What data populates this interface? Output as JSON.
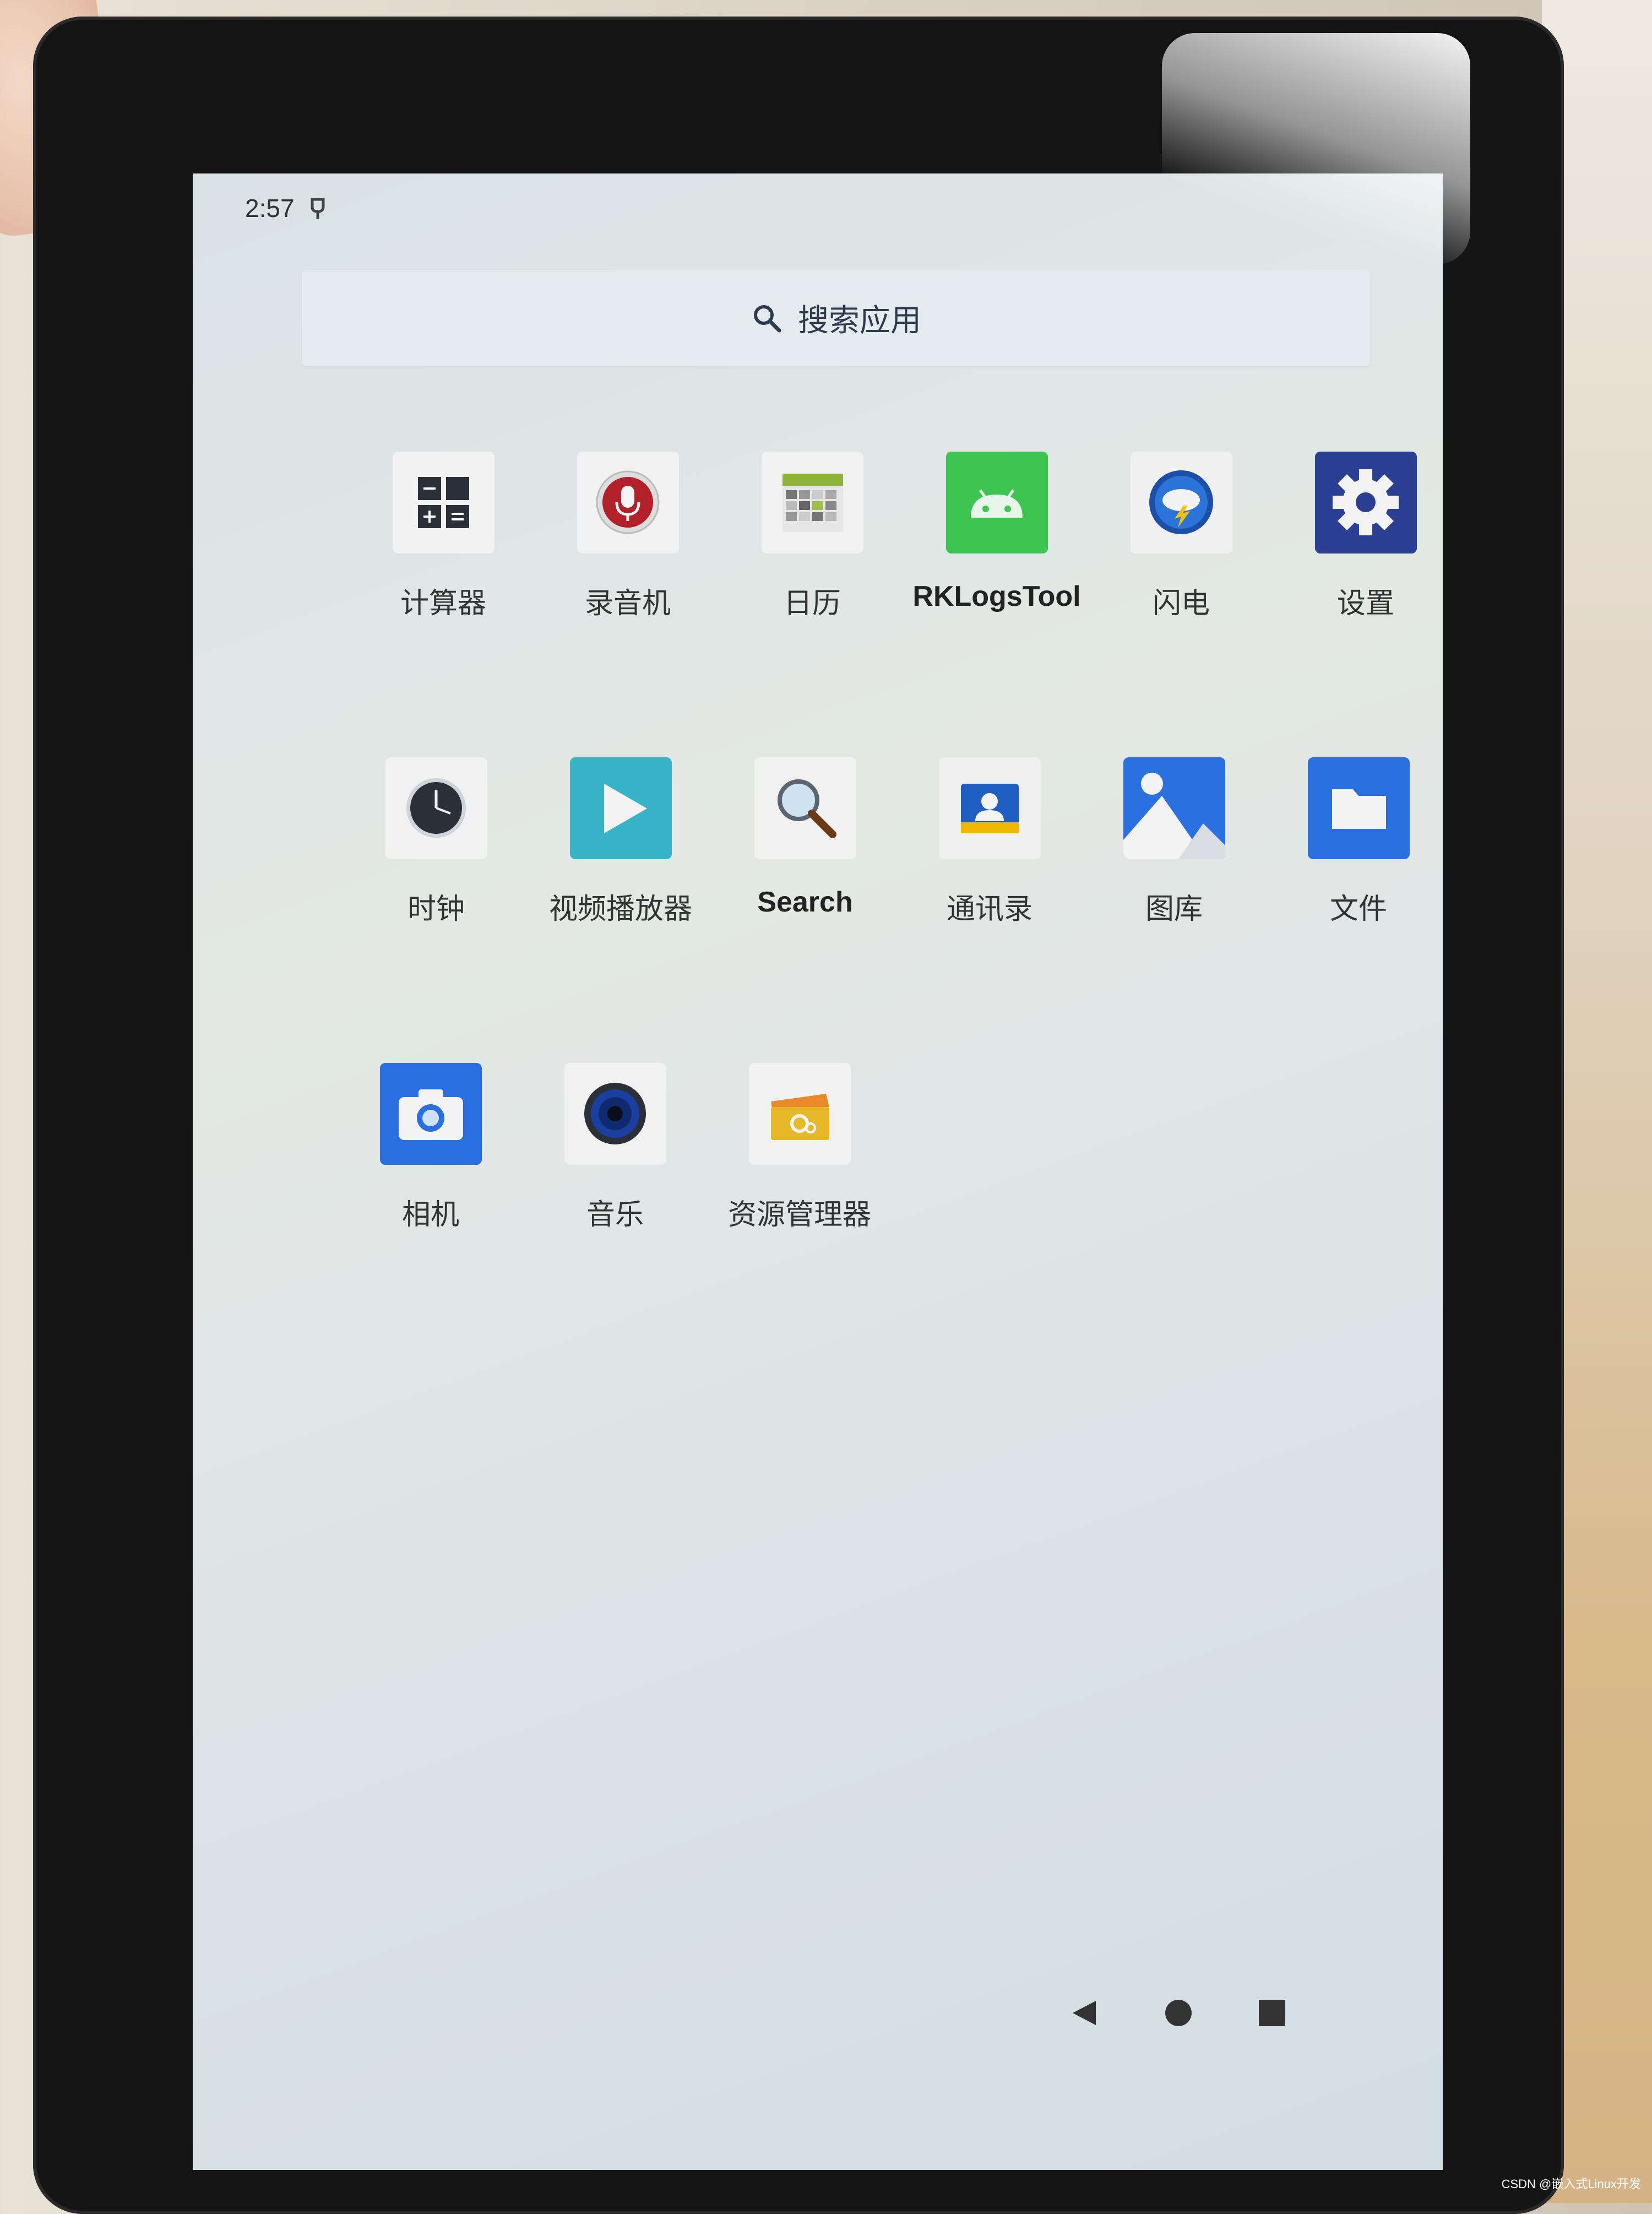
{
  "status_bar": {
    "time": "2:57"
  },
  "search": {
    "label": "搜索应用"
  },
  "apps": [
    {
      "id": "calculator",
      "label": "计算器",
      "icon": "calculator-icon"
    },
    {
      "id": "recorder",
      "label": "录音机",
      "icon": "microphone-icon"
    },
    {
      "id": "calendar",
      "label": "日历",
      "icon": "calendar-icon"
    },
    {
      "id": "rklogstool",
      "label": "RKLogsTool",
      "icon": "android-icon"
    },
    {
      "id": "flash",
      "label": "闪电",
      "icon": "lightning-icon"
    },
    {
      "id": "settings",
      "label": "设置",
      "icon": "gear-icon"
    },
    {
      "id": "clock",
      "label": "时钟",
      "icon": "clock-icon"
    },
    {
      "id": "video-player",
      "label": "视频播放器",
      "icon": "play-icon"
    },
    {
      "id": "search",
      "label": "Search",
      "icon": "magnifier-icon"
    },
    {
      "id": "contacts",
      "label": "通讯录",
      "icon": "contacts-icon"
    },
    {
      "id": "gallery",
      "label": "图库",
      "icon": "gallery-icon"
    },
    {
      "id": "files",
      "label": "文件",
      "icon": "folder-icon"
    },
    {
      "id": "camera",
      "label": "相机",
      "icon": "camera-icon"
    },
    {
      "id": "music",
      "label": "音乐",
      "icon": "music-icon"
    },
    {
      "id": "file-manager",
      "label": "资源管理器",
      "icon": "file-manager-icon"
    }
  ],
  "nav": {
    "back": "back-icon",
    "home": "home-icon",
    "recents": "recents-icon"
  },
  "watermark": "CSDN @嵌入式Linux开发"
}
